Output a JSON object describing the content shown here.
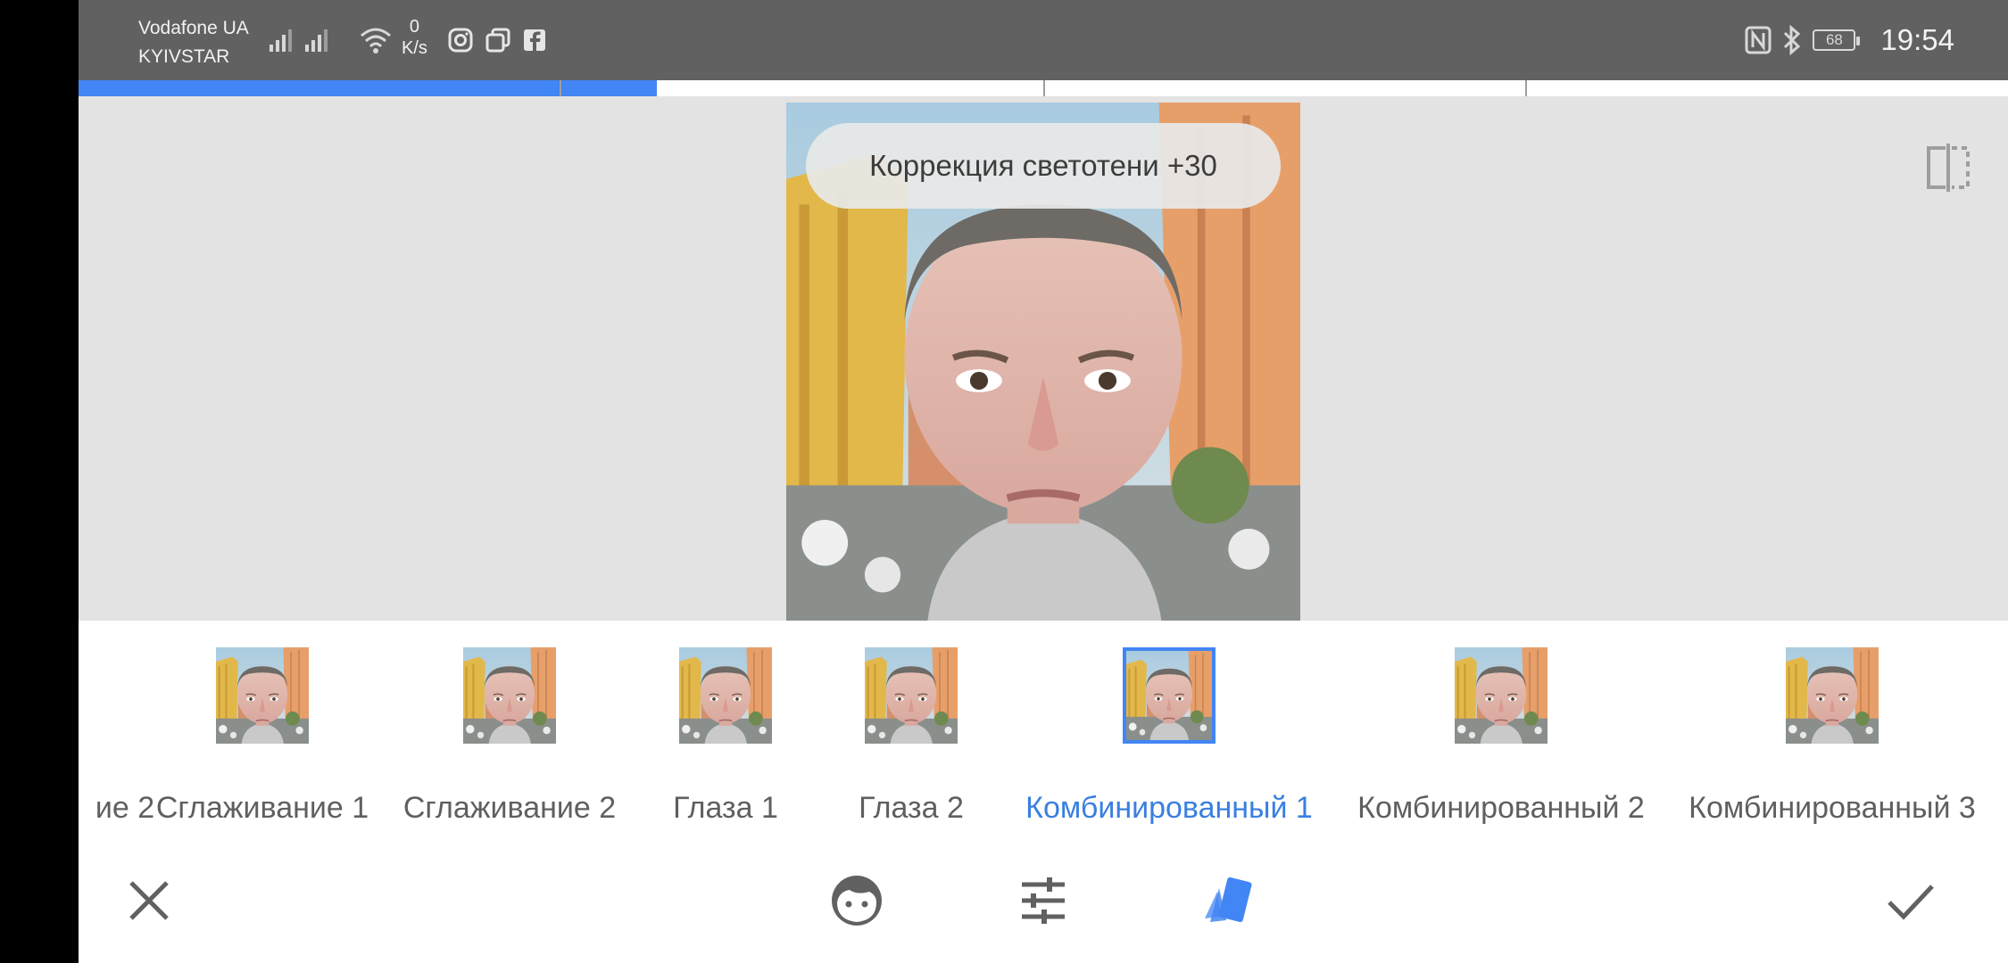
{
  "status_bar": {
    "carrier_1": "Vodafone UA",
    "carrier_2": "KYIVSTAR",
    "speed_value": "0",
    "speed_unit": "K/s",
    "battery": "68",
    "time": "19:54",
    "icons": [
      "signal-icon",
      "signal-icon",
      "wifi-icon",
      "instagram-icon",
      "multi-window-icon",
      "facebook-icon",
      "nfc-icon",
      "bluetooth-icon",
      "battery-icon"
    ]
  },
  "editor": {
    "toast": "Коррекция светотени +30",
    "compare_icon": "compare-split-icon"
  },
  "filters": {
    "items": [
      {
        "label": "ие 2"
      },
      {
        "label": "Сглаживание 1"
      },
      {
        "label": "Сглаживание 2"
      },
      {
        "label": "Глаза 1"
      },
      {
        "label": "Глаза 2"
      },
      {
        "label": "Комбинированный 1"
      },
      {
        "label": "Комбинированный 2"
      },
      {
        "label": "Комбинированный 3"
      }
    ],
    "selected": "Комбинированный 1",
    "accent": "#4285f4"
  },
  "toolbar": {
    "icons": [
      "close-icon",
      "face-icon",
      "tune-icon",
      "styles-icon",
      "check-icon"
    ],
    "styles_color": "#4285f4"
  }
}
